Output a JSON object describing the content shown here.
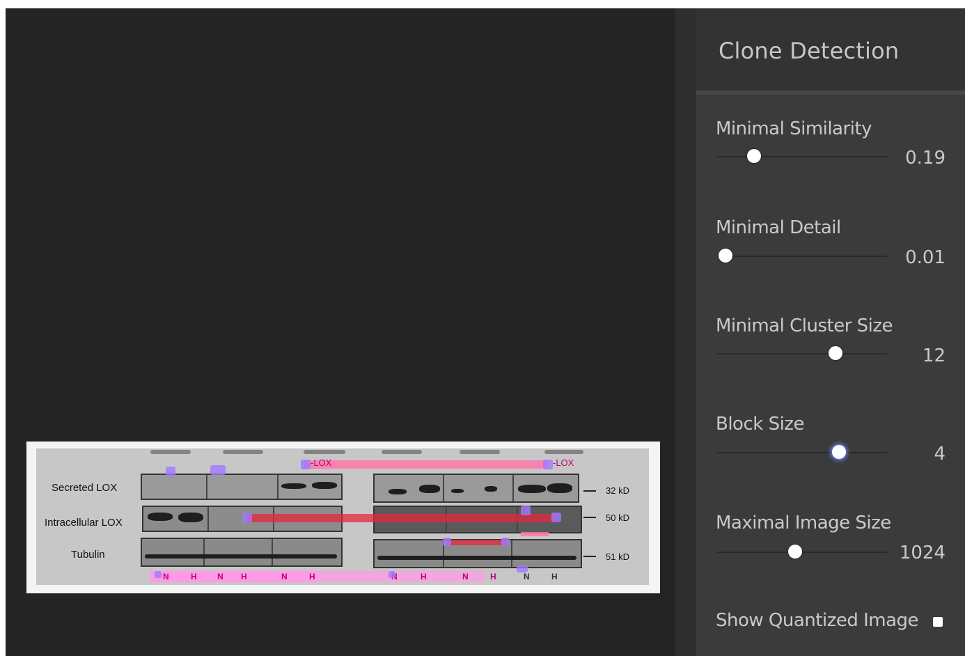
{
  "panel": {
    "title": "Clone Detection",
    "controls": [
      {
        "label": "Minimal Similarity",
        "value": "0.19"
      },
      {
        "label": "Minimal Detail",
        "value": "0.01"
      },
      {
        "label": "Minimal Cluster Size",
        "value": "12"
      },
      {
        "label": "Block Size",
        "value": "4"
      },
      {
        "label": "Maximal Image Size",
        "value": "1024"
      }
    ],
    "checkbox_label": "Show Quantized Image"
  },
  "figure": {
    "rows": [
      "Secreted LOX",
      "Intracellular LOX",
      "Tubulin"
    ],
    "markers": [
      "32 kD",
      "50 kD",
      "51 kD"
    ],
    "top_labels": [
      "-LOX",
      "-LOX"
    ],
    "lanes": [
      "N",
      "H",
      "N",
      "H",
      "N",
      "H",
      "N",
      "H",
      "N",
      "H",
      "N",
      "H"
    ]
  },
  "colors": {
    "canvas": "#242424",
    "panel": "#3b3b3b",
    "clone_highlight": "#ff78aa",
    "clone_match": "#e6283c",
    "keypoint": "#a078ff"
  }
}
